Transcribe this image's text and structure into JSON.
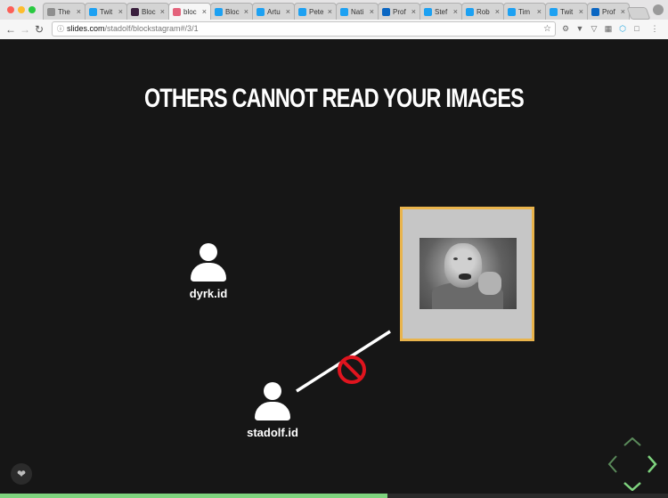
{
  "browser": {
    "tabs": [
      {
        "label": "The",
        "favicon": "grey",
        "active": false
      },
      {
        "label": "Twit",
        "favicon": "twitter",
        "active": false
      },
      {
        "label": "Bloc",
        "favicon": "dark",
        "active": false
      },
      {
        "label": "bloc",
        "favicon": "slides",
        "active": true
      },
      {
        "label": "Bloc",
        "favicon": "twitter",
        "active": false
      },
      {
        "label": "Artu",
        "favicon": "twitter",
        "active": false
      },
      {
        "label": "Pete",
        "favicon": "twitter",
        "active": false
      },
      {
        "label": "Nati",
        "favicon": "twitter",
        "active": false
      },
      {
        "label": "Prof",
        "favicon": "linkedin",
        "active": false
      },
      {
        "label": "Stef",
        "favicon": "twitter",
        "active": false
      },
      {
        "label": "Rob",
        "favicon": "twitter",
        "active": false
      },
      {
        "label": "Tim",
        "favicon": "twitter",
        "active": false
      },
      {
        "label": "Twit",
        "favicon": "twitter",
        "active": false
      },
      {
        "label": "Prof",
        "favicon": "linkedin",
        "active": false
      }
    ],
    "url_host": "slides.com",
    "url_path": "/stadolf/blockstagram#/3/1"
  },
  "slide": {
    "title": "OTHERS CANNOT READ YOUR IMAGES",
    "users": {
      "first": "dyrk.id",
      "second": "stadolf.id"
    }
  },
  "progress": {
    "fraction": 0.58
  },
  "colors": {
    "background": "#161616",
    "frame_border": "#e9b44c",
    "ban_red": "#e0141e",
    "progress": "#7ed37e",
    "nav_arrows": "#7ed37e"
  }
}
